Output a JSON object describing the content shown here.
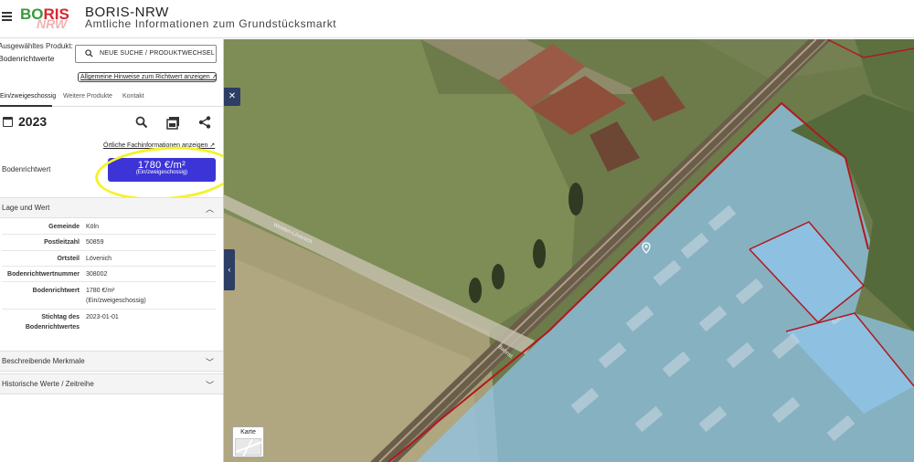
{
  "header": {
    "logo_text_1": "BO",
    "logo_text_2": "RIS",
    "logo_sub": "NRW",
    "title": "BORIS-NRW",
    "subtitle": "Amtliche Informationen zum Grundstücksmarkt"
  },
  "product": {
    "label": "Ausgewähltes Produkt:",
    "value": "Bodenrichtwerte",
    "search_button": "NEUE SUCHE / PRODUKTWECHSEL",
    "hint_link": "Allgemeine Hinweise zum Richtwert anzeigen ↗"
  },
  "tabs": [
    {
      "label": "Ein/zweigeschossig"
    },
    {
      "label": "Weitere Produkte"
    },
    {
      "label": "Kontakt"
    }
  ],
  "year": "2023",
  "fach_link": "Örtliche Fachinformationen anzeigen ↗",
  "bodenrichtwert": {
    "label": "Bodenrichtwert",
    "value": "1780 €/m²",
    "sub": "(Ein/zweigeschossig)"
  },
  "sections": {
    "lage": "Lage und Wert",
    "merkmale": "Beschreibende Merkmale",
    "historisch": "Historische Werte / Zeitreihe"
  },
  "details": [
    {
      "key": "Gemeinde",
      "value": "Köln"
    },
    {
      "key": "Postleitzahl",
      "value": "50859"
    },
    {
      "key": "Ortsteil",
      "value": "Lövenich"
    },
    {
      "key": "Bodenrichtwertnummer",
      "value": "308002"
    },
    {
      "key": "Bodenrichtwert",
      "value": "1780 €/m²",
      "value2": "(Ein/zweigeschossig)"
    },
    {
      "key": "Stichtag des",
      "key2": "Bodenrichtwertes",
      "value": "2023-01-01"
    }
  ],
  "map": {
    "street_1": "Weiden-Lövenich",
    "street_2": "Bahnst.",
    "street_3": "Sch...",
    "karte_label": "Karte",
    "close_symbol": "✕",
    "collapse_symbol": "‹"
  },
  "colors": {
    "accent": "#3c34d6",
    "highlight": "#f4f22a",
    "overlay": "#8fc4e8",
    "border_red": "#b0181e",
    "nav_dark": "#2c3e64"
  }
}
